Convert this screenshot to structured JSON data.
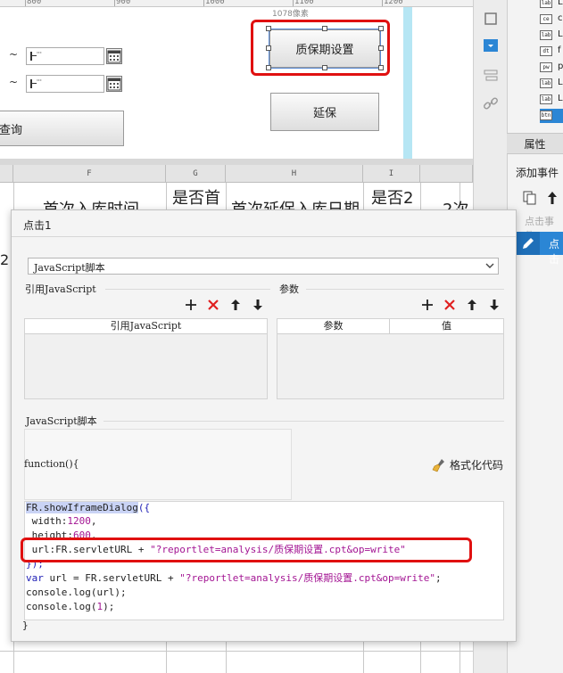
{
  "ruler": {
    "ticks": [
      "800",
      "900",
      "1000",
      "1100",
      "1200"
    ],
    "width_label": "1078像素"
  },
  "form": {
    "date_separator": "~",
    "query_button": "查询",
    "shelf_life_button": "质保期设置",
    "extend_button": "延保"
  },
  "sheet": {
    "columns": [
      "F",
      "G",
      "H",
      "I"
    ],
    "headers": [
      "首次入库时间",
      "是否首",
      "首次延保入库日期",
      "是否2",
      "2次"
    ],
    "row_mark": "2"
  },
  "right_panel": {
    "widgets": [
      "L",
      "c",
      "L",
      "f",
      "p",
      "L",
      "L",
      ""
    ],
    "widget_icons": [
      "lab",
      "ce",
      "lab",
      "dt",
      "pw",
      "lab",
      "lab",
      "btn"
    ],
    "properties_title": "属性",
    "add_event_label": "添加事件",
    "event_hint": "点击事件",
    "event_item": "点击"
  },
  "dialog": {
    "title": "点击1",
    "script_type": "JavaScript脚本",
    "ref_js_label": "引用JavaScript",
    "params_label": "参数",
    "ref_table_header": "引用JavaScript",
    "param_table_headers": [
      "参数",
      "值"
    ],
    "script_label": "JavaScript脚本",
    "function_signature": "function(){",
    "format_button": "格式化代码",
    "closing_brace": "}",
    "code": {
      "line1": "FR.showIframeDialog",
      "line1_tail": "({",
      "line2_key": " width:",
      "line2_val": "1200",
      "line3_key": " height:",
      "line3_val": "600",
      "line4_key": " url:FR.servletURL + ",
      "line4_str": "\"?reportlet=analysis/质保期设置.cpt&op=write\"",
      "line5": "});",
      "line6_kw": "var",
      "line6_mid": " url = FR.servletURL + ",
      "line6_str": "\"?reportlet=analysis/质保期设置.cpt&op=write\"",
      "line6_tail": ";",
      "line7": "console.log(url);",
      "line8_head": "console.log(",
      "line8_num": "1",
      "line8_tail": ");"
    }
  }
}
